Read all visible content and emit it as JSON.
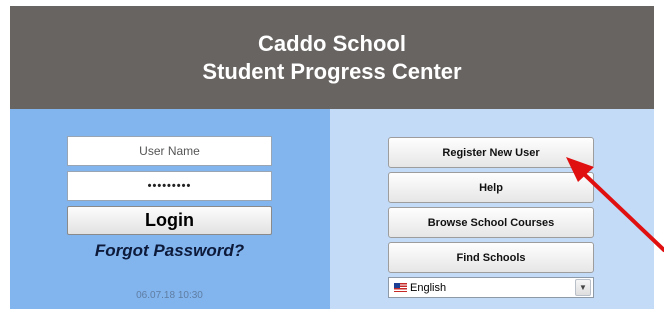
{
  "header": {
    "line1": "Caddo School",
    "line2": "Student Progress Center"
  },
  "login": {
    "username_placeholder": "User Name",
    "password_mask": "•••••••••",
    "login_label": "Login",
    "forgot_label": "Forgot Password?",
    "datetime": "06.07.18 10:30"
  },
  "actions": {
    "register_label": "Register New User",
    "help_label": "Help",
    "browse_label": "Browse School Courses",
    "find_label": "Find Schools"
  },
  "language": {
    "selected": "English",
    "flag_icon": "us-flag-icon"
  },
  "colors": {
    "header_bg": "#686462",
    "left_panel_bg": "#82b4ee",
    "right_panel_bg": "#c3dbf7",
    "annotation_arrow": "#e01010"
  }
}
